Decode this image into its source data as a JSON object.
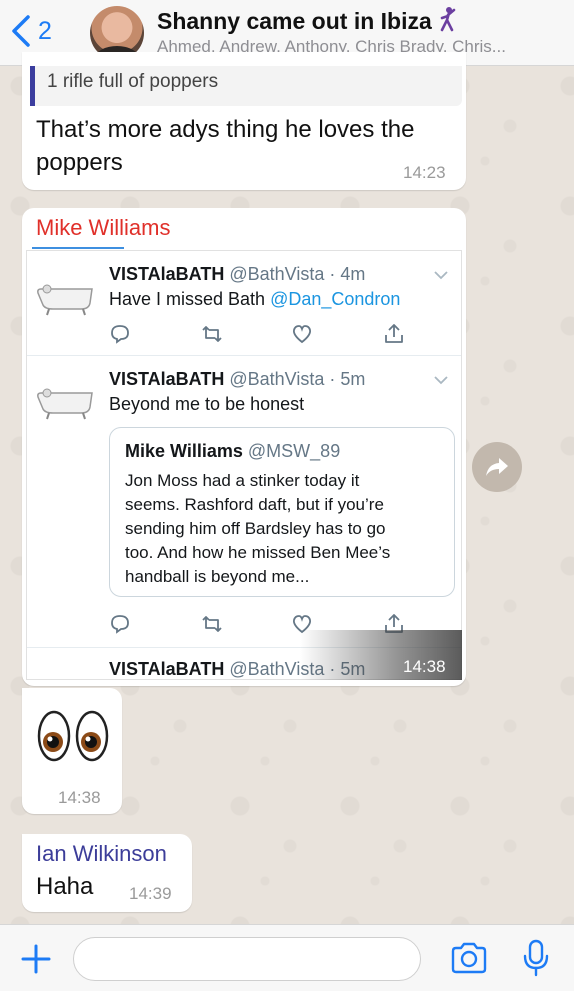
{
  "header": {
    "back_count": "2",
    "title": "Shanny came out in Ibiza",
    "subtitle": "Ahmed, Andrew, Anthony, Chris Brady, Chris..."
  },
  "messages": [
    {
      "quote": "1 rifle full of poppers",
      "text_line1": "That’s more adys thing he loves the",
      "text_line2": "poppers",
      "time": "14:23"
    },
    {
      "sender": "Mike Williams",
      "sender_color": "#e0302a",
      "tweets": [
        {
          "name": "VISTAlaBATH",
          "handle": "@BathVista · 4m",
          "text": "Have I missed Bath ",
          "link": "@Dan_Condron"
        },
        {
          "name": "VISTAlaBATH",
          "handle": "@BathVista · 5m",
          "text": "Beyond me to be honest",
          "quoted": {
            "name": "Mike Williams",
            "handle": "@MSW_89",
            "lines": [
              "Jon Moss had a stinker today it",
              "seems. Rashford daft, but if you’re",
              "sending him off Bardsley has to go",
              "too. And how he missed Ben Mee’s",
              "handball is beyond me..."
            ]
          }
        },
        {
          "name": "VISTAlaBATH",
          "handle": "@BathVista · 5m"
        }
      ],
      "time": "14:38"
    },
    {
      "emoji": "eyes",
      "time": "14:38"
    },
    {
      "sender": "Ian Wilkinson",
      "sender_color": "#3c3d99",
      "text": "Haha",
      "time": "14:39"
    }
  ],
  "colors": {
    "ios_blue": "#1d7bf5",
    "twitter_link": "#1b95e0"
  }
}
